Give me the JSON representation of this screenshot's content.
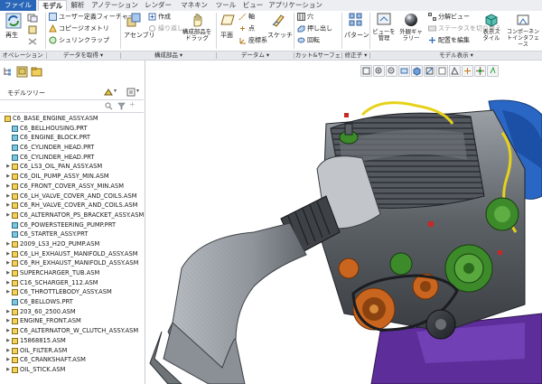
{
  "menu_tabs": [
    {
      "label": "ファイル"
    },
    {
      "label": "モデル"
    },
    {
      "label": "解析"
    },
    {
      "label": "アノテーション"
    },
    {
      "label": "レンダー"
    },
    {
      "label": "マネキン"
    },
    {
      "label": "ツール"
    },
    {
      "label": "ビュー"
    },
    {
      "label": "アプリケーション"
    }
  ],
  "ribbon": {
    "regen_label": "再生",
    "user_feature": "ユーザー定義フィーチャー",
    "copy_geometry": "コピージオメトリ",
    "shrinkwrap": "シュリンクラップ",
    "create": "作成",
    "repeat": "繰り返し",
    "assemble": "アセンブリ",
    "drag_components": "構成部品をドラッグ",
    "plane": "平面",
    "axis": "軸",
    "point": "点",
    "csys": "座標系",
    "sketch": "スケッチ",
    "hole": "穴",
    "extrude": "押し出し",
    "revolve": "回転",
    "pattern": "パターン",
    "manage_views": "ビューを管理",
    "appearance": "外観ギャラリー",
    "explode_view": "分解ビュー",
    "toggle_status": "ステータスを切り替え",
    "edit_position": "配置を編集",
    "display_style": "表示スタイル",
    "component_interface": "コンポーネントインタフェース"
  },
  "groups": [
    {
      "label": "オペレーション"
    },
    {
      "label": "データを取得"
    },
    {
      "label": "構成部品"
    },
    {
      "label": "データム"
    },
    {
      "label": "カット&サーフェス"
    },
    {
      "label": "修正子"
    },
    {
      "label": "モデル表示"
    }
  ],
  "model_tree": {
    "title": "モデルツリー",
    "items": [
      {
        "label": "C6_BASE_ENGINE_ASSY.ASM",
        "indent": 0,
        "expandable": false,
        "kind": "asm"
      },
      {
        "label": "C6_BELLHOUSING.PRT",
        "indent": 1,
        "expandable": false,
        "kind": "prt"
      },
      {
        "label": "C6_ENGINE_BLOCK.PRT",
        "indent": 1,
        "expandable": false,
        "kind": "prt"
      },
      {
        "label": "C6_CYLINDER_HEAD.PRT",
        "indent": 1,
        "expandable": false,
        "kind": "prt"
      },
      {
        "label": "C6_CYLINDER_HEAD.PRT",
        "indent": 1,
        "expandable": false,
        "kind": "prt"
      },
      {
        "label": "C6_LS3_OIL_PAN_ASSY.ASM",
        "indent": 1,
        "expandable": true,
        "kind": "asm"
      },
      {
        "label": "C6_OIL_PUMP_ASSY_MIN.ASM",
        "indent": 1,
        "expandable": true,
        "kind": "asm"
      },
      {
        "label": "C6_FRONT_COVER_ASSY_MIN.ASM",
        "indent": 1,
        "expandable": true,
        "kind": "asm"
      },
      {
        "label": "C6_LH_VALVE_COVER_AND_COILS.ASM",
        "indent": 1,
        "expandable": true,
        "kind": "asm"
      },
      {
        "label": "C6_RH_VALVE_COVER_AND_COILS.ASM",
        "indent": 1,
        "expandable": true,
        "kind": "asm"
      },
      {
        "label": "C6_ALTERNATOR_PS_BRACKET_ASSY.ASM",
        "indent": 1,
        "expandable": true,
        "kind": "asm"
      },
      {
        "label": "C6_POWERSTEERING_PUMP.PRT",
        "indent": 1,
        "expandable": false,
        "kind": "prt"
      },
      {
        "label": "C6_STARTER_ASSY.PRT",
        "indent": 1,
        "expandable": false,
        "kind": "prt"
      },
      {
        "label": "2009_LS3_H2O_PUMP.ASM",
        "indent": 1,
        "expandable": true,
        "kind": "asm"
      },
      {
        "label": "C6_LH_EXHAUST_MANIFOLD_ASSY.ASM",
        "indent": 1,
        "expandable": true,
        "kind": "asm"
      },
      {
        "label": "C6_RH_EXHAUST_MANIFOLD_ASSY.ASM",
        "indent": 1,
        "expandable": true,
        "kind": "asm"
      },
      {
        "label": "SUPERCHARGER_TUB.ASM",
        "indent": 1,
        "expandable": true,
        "kind": "asm"
      },
      {
        "label": "C16_SCHARGER_112.ASM",
        "indent": 1,
        "expandable": true,
        "kind": "asm"
      },
      {
        "label": "C6_THROTTLEBODY_ASSY.ASM",
        "indent": 1,
        "expandable": true,
        "kind": "asm"
      },
      {
        "label": "C6_BELLOWS.PRT",
        "indent": 1,
        "expandable": false,
        "kind": "prt"
      },
      {
        "label": "203_60_2500.ASM",
        "indent": 1,
        "expandable": true,
        "kind": "asm"
      },
      {
        "label": "ENGINE_FRONT.ASM",
        "indent": 1,
        "expandable": true,
        "kind": "asm"
      },
      {
        "label": "C6_ALTERNATOR_W_CLUTCH_ASSY.ASM",
        "indent": 1,
        "expandable": true,
        "kind": "asm"
      },
      {
        "label": "15868815.ASM",
        "indent": 1,
        "expandable": true,
        "kind": "asm"
      },
      {
        "label": "OIL_FILTER.ASM",
        "indent": 1,
        "expandable": true,
        "kind": "asm"
      },
      {
        "label": "C6_CRANKSHAFT.ASM",
        "indent": 1,
        "expandable": true,
        "kind": "asm"
      },
      {
        "label": "OIL_STICK.ASM",
        "indent": 1,
        "expandable": true,
        "kind": "asm"
      }
    ]
  },
  "colors": {
    "file_tab": "#2a66b8",
    "engine_gray": "#6e7378",
    "engine_dark": "#2f3338",
    "engine_green": "#3d8a2a",
    "engine_orange": "#c9651e",
    "engine_purple": "#5d2d9a",
    "engine_blue": "#2a67c4",
    "engine_yellow": "#e6d21a"
  }
}
